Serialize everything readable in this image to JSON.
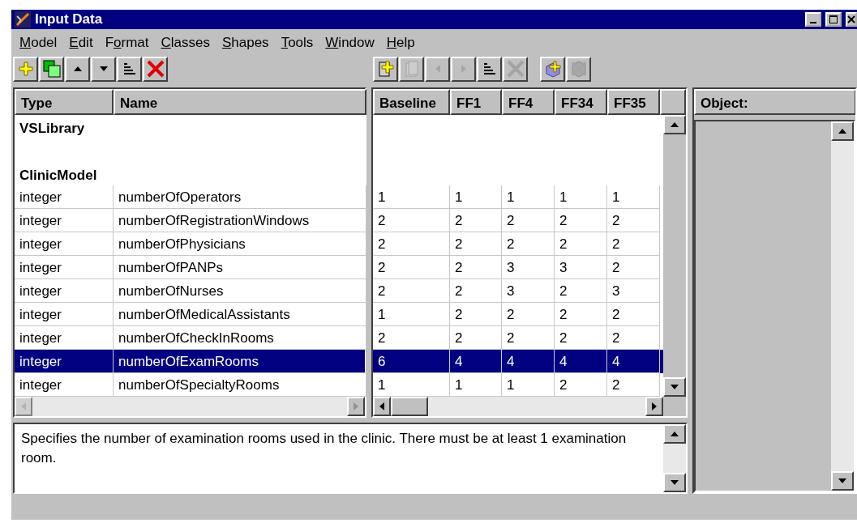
{
  "window": {
    "title": "Input Data"
  },
  "menu": [
    {
      "key": "M",
      "post": "odel"
    },
    {
      "key": "E",
      "post": "dit"
    },
    {
      "pre": "F",
      "key": "o",
      "post": "rmat"
    },
    {
      "key": "C",
      "post": "lasses"
    },
    {
      "key": "S",
      "post": "hapes"
    },
    {
      "key": "T",
      "post": "ools"
    },
    {
      "key": "W",
      "post": "indow"
    },
    {
      "key": "H",
      "post": "elp"
    }
  ],
  "toolbar_left": [
    {
      "kind": "add",
      "disabled": false
    },
    {
      "kind": "copy",
      "disabled": false
    },
    {
      "kind": "up",
      "disabled": false
    },
    {
      "kind": "down",
      "disabled": false
    },
    {
      "kind": "sort",
      "disabled": false
    },
    {
      "kind": "delete",
      "disabled": false
    }
  ],
  "toolbar_right": [
    {
      "kind": "page-add",
      "disabled": false
    },
    {
      "kind": "pages",
      "disabled": true
    },
    {
      "kind": "left",
      "disabled": true
    },
    {
      "kind": "right",
      "disabled": true
    },
    {
      "kind": "sort",
      "disabled": false
    },
    {
      "kind": "delete",
      "disabled": true
    },
    {
      "kind": "gap"
    },
    {
      "kind": "cube-add",
      "disabled": false
    },
    {
      "kind": "cube-delete",
      "disabled": true
    }
  ],
  "left_columns": [
    "Type",
    "Name"
  ],
  "scenario_columns": [
    "Baseline",
    "FF1",
    "FF4",
    "FF34",
    "FF35"
  ],
  "rows": [
    {
      "kind": "section",
      "name": "VSLibrary"
    },
    {
      "kind": "blank"
    },
    {
      "kind": "section",
      "name": "ClinicModel"
    },
    {
      "kind": "item",
      "type": "integer",
      "name": "numberOfOperators",
      "values": [
        "1",
        "1",
        "1",
        "1",
        "1"
      ],
      "selected": false
    },
    {
      "kind": "item",
      "type": "integer",
      "name": "numberOfRegistrationWindows",
      "values": [
        "2",
        "2",
        "2",
        "2",
        "2"
      ],
      "selected": false
    },
    {
      "kind": "item",
      "type": "integer",
      "name": "numberOfPhysicians",
      "values": [
        "2",
        "2",
        "2",
        "2",
        "2"
      ],
      "selected": false
    },
    {
      "kind": "item",
      "type": "integer",
      "name": "numberOfPANPs",
      "values": [
        "2",
        "2",
        "3",
        "3",
        "2"
      ],
      "selected": false
    },
    {
      "kind": "item",
      "type": "integer",
      "name": "numberOfNurses",
      "values": [
        "2",
        "2",
        "3",
        "2",
        "3"
      ],
      "selected": false
    },
    {
      "kind": "item",
      "type": "integer",
      "name": "numberOfMedicalAssistants",
      "values": [
        "1",
        "2",
        "2",
        "2",
        "2"
      ],
      "selected": false
    },
    {
      "kind": "item",
      "type": "integer",
      "name": "numberOfCheckInRooms",
      "values": [
        "2",
        "2",
        "2",
        "2",
        "2"
      ],
      "selected": false
    },
    {
      "kind": "item",
      "type": "integer",
      "name": "numberOfExamRooms",
      "values": [
        "6",
        "4",
        "4",
        "4",
        "4"
      ],
      "selected": true
    },
    {
      "kind": "item",
      "type": "integer",
      "name": "numberOfSpecialtyRooms",
      "values": [
        "1",
        "1",
        "1",
        "2",
        "2"
      ],
      "selected": false
    }
  ],
  "description": "Specifies the number of examination rooms used in the clinic.  There must be at least 1 examination room.",
  "object_panel": {
    "header": "Object:"
  }
}
